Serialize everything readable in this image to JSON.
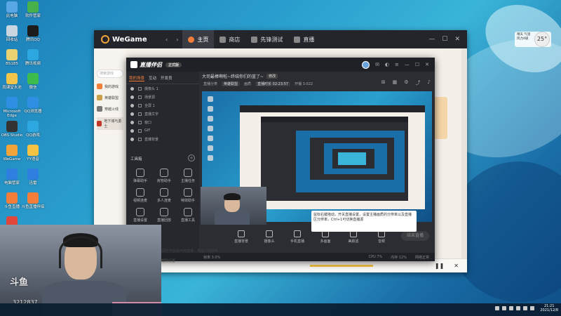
{
  "desktop": {
    "icons_left": [
      {
        "label": "此电脑",
        "color": "#5aa7e6"
      },
      {
        "label": "回收站",
        "color": "#c9d6e0"
      },
      {
        "label": "BS185",
        "color": "#e8d272"
      },
      {
        "label": "雨课堂水池",
        "color": "#f0c54a"
      },
      {
        "label": "Microsoft Edge",
        "color": "#2f8fe3"
      },
      {
        "label": "OBS Studio",
        "color": "#333333"
      },
      {
        "label": "WeGame",
        "color": "#f2a33a"
      },
      {
        "label": "电脑管家",
        "color": "#2f7fe0"
      },
      {
        "label": "斗鱼直播",
        "color": "#f27e3a"
      },
      {
        "label": "",
        "color": "#e0463a"
      }
    ],
    "icons_right": [
      {
        "label": "软件管家",
        "color": "#48b04a"
      },
      {
        "label": "腾讯QQ",
        "color": "#1c1c1c"
      },
      {
        "label": "腾讯视频",
        "color": "#2ca7e0"
      },
      {
        "label": "微信",
        "color": "#3dbb4c"
      },
      {
        "label": "QQ浏览器",
        "color": "#2f8fe3"
      },
      {
        "label": "QQ游戏",
        "color": "#2ca7e0"
      },
      {
        "label": "YY语音",
        "color": "#f6c343"
      },
      {
        "label": "迅雷",
        "color": "#2f7fe0"
      },
      {
        "label": "斗鱼直播伴侣",
        "color": "#f27e3a"
      }
    ]
  },
  "wegame": {
    "logo": "WeGame",
    "tabs": [
      {
        "label": "主页",
        "active": true
      },
      {
        "label": "商店",
        "active": false
      },
      {
        "label": "先锋测试",
        "active": false
      },
      {
        "label": "直播",
        "active": false
      }
    ],
    "search_placeholder": "搜索游戏",
    "games": [
      {
        "label": "我的游戏",
        "color": "#f27e3a"
      },
      {
        "label": "英雄联盟",
        "color": "#c9a14a"
      },
      {
        "label": "穿越火线",
        "color": "#777777"
      },
      {
        "label": "地下城与勇士",
        "color": "#c0392b"
      }
    ]
  },
  "douyu": {
    "logo": "直播伴侣",
    "version": "正式版",
    "tabs": [
      "我的场景",
      "互动",
      "开发员"
    ],
    "scenes": [
      "摄像头 1",
      "场景源",
      "全屏 1",
      "直播文字",
      "窗口",
      "GIF",
      "直播背景"
    ],
    "tools_title": "工具箱",
    "tools": [
      {
        "label": "弹幕助手"
      },
      {
        "label": "房管助手"
      },
      {
        "label": "主播任务"
      },
      {
        "label": "视频连麦"
      },
      {
        "label": "多人连麦"
      },
      {
        "label": "特效助手"
      },
      {
        "label": "直播设置"
      },
      {
        "label": "直播回放"
      },
      {
        "label": "直播工具"
      }
    ],
    "topic": "大司最棒啊啦~终结你们的蓝了~",
    "topic_tag": "修改",
    "sub_info": [
      "直播分类",
      "英雄联盟",
      "画质",
      "直播时长 02:23:57",
      "开播 3:022"
    ],
    "controls": [
      "直播背景",
      "摄像头",
      "手机直播",
      "多画面",
      "美颜滤",
      "音频"
    ],
    "start_button": "结束直播",
    "tip": "鼠标右键拖动，开关直播设置，设置主播画质的分辨率以及直播区分辨率，Ctrl+1可切换直播源",
    "status_left": "帧率 3.0%",
    "status_right": [
      "CPU 7%",
      "内存 12%",
      "网络正常"
    ],
    "bottom_note": "内网打开后会开启直播，再运行后即可",
    "link": "帮助设置"
  },
  "overlay": {
    "watermark": "斗鱼",
    "room_id": "3212837"
  },
  "weather": {
    "line1": "晴天 气温",
    "line2": "风力4级",
    "temp": "25°"
  },
  "taskbar": {
    "time": "21:21",
    "date": "2021/12/8"
  }
}
